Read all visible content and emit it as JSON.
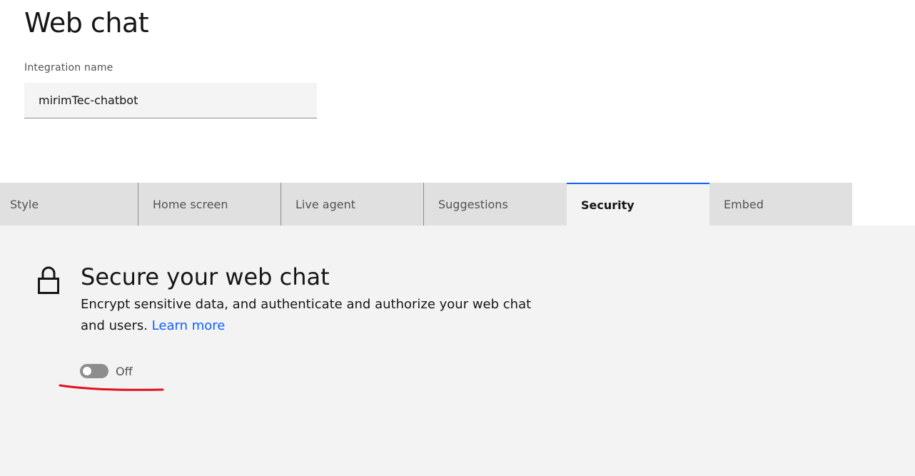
{
  "page": {
    "title": "Web chat"
  },
  "integration": {
    "label": "Integration name",
    "value": "mirimTec-chatbot"
  },
  "tabs": [
    {
      "label": "Style"
    },
    {
      "label": "Home screen"
    },
    {
      "label": "Live agent"
    },
    {
      "label": "Suggestions"
    },
    {
      "label": "Security",
      "active": true
    },
    {
      "label": "Embed"
    }
  ],
  "security": {
    "title": "Secure your web chat",
    "description": "Encrypt sensitive data, and authenticate and authorize your web chat and users.",
    "learn_more": "Learn more",
    "toggle_state": "Off",
    "toggle_on": false
  },
  "colors": {
    "accent": "#0f62fe",
    "annotation": "#e0101b"
  },
  "icons": {
    "lock": "lock-icon"
  }
}
